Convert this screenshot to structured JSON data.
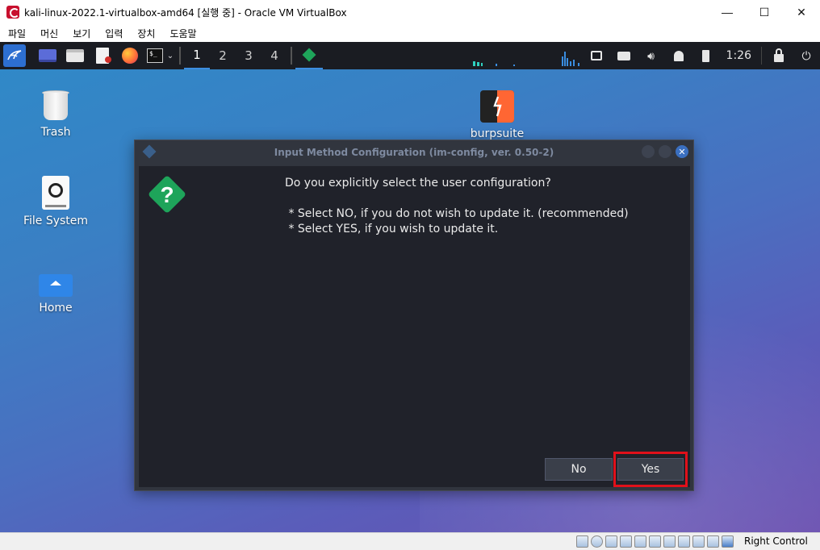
{
  "host": {
    "title": "kali-linux-2022.1-virtualbox-amd64 [실행 중] - Oracle VM VirtualBox",
    "menu": [
      "파일",
      "머신",
      "보기",
      "입력",
      "장치",
      "도움말"
    ],
    "controls": {
      "minimize": "—",
      "maximize": "☐",
      "close": "✕"
    },
    "host_key": "Right Control"
  },
  "panel": {
    "workspaces": [
      "1",
      "2",
      "3",
      "4"
    ],
    "active_workspace": "1",
    "clock": "1:26"
  },
  "desktop": {
    "icons": [
      {
        "label": "Trash",
        "icon": "trash-icon"
      },
      {
        "label": "File System",
        "icon": "drive-icon"
      },
      {
        "label": "Home",
        "icon": "home-folder-icon"
      },
      {
        "label": "burpsuite",
        "icon": "burpsuite-icon"
      }
    ]
  },
  "dialog": {
    "title": "Input Method Configuration (im-config, ver. 0.50-2)",
    "question": "Do you explicitly select the user configuration?",
    "line1": " * Select NO, if you do not wish to update it. (recommended)",
    "line2": " * Select YES, if you wish to update it.",
    "no_label": "No",
    "yes_label": "Yes"
  },
  "colors": {
    "dialog_bg": "#20222a",
    "accent_green": "#1ea45a",
    "highlight_red": "#e0101a",
    "panel_bg": "#1a1c22"
  }
}
